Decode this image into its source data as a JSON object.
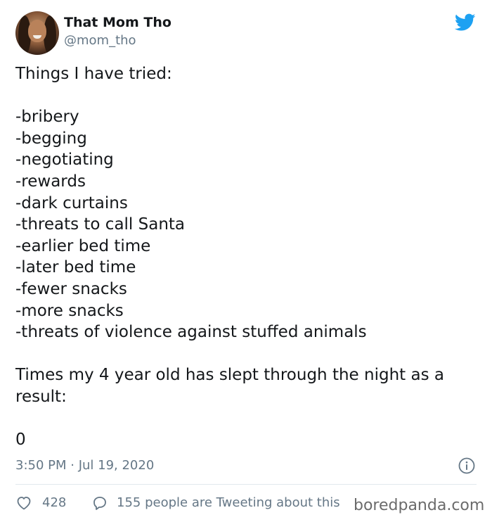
{
  "author": {
    "name": "That Mom Tho",
    "handle": "@mom_tho",
    "avatar": "profile-photo"
  },
  "platform_icon": "twitter-bird-icon",
  "accent_color": "#1da1f2",
  "tweet": {
    "intro": "Things I have tried:",
    "items": [
      "-bribery",
      "-begging",
      "-negotiating",
      "-rewards",
      "-dark curtains",
      "-threats to call Santa",
      "-earlier bed time",
      "-later bed time",
      "-fewer snacks",
      "-more snacks",
      "-threats of violence against stuffed animals"
    ],
    "result_question": "Times my 4 year old has slept through the night as a result:",
    "result_value": "0"
  },
  "timestamp": "3:50 PM · Jul 19, 2020",
  "engagement": {
    "likes": "428",
    "tweeting_about": "155 people are Tweeting about this"
  },
  "watermark": "boredpanda.com"
}
